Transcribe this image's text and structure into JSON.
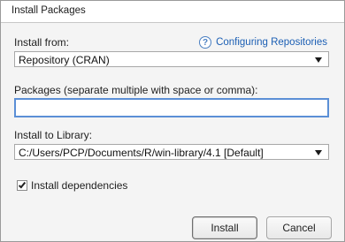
{
  "window": {
    "title": "Install Packages"
  },
  "install_from": {
    "label": "Install from:",
    "selected": "Repository (CRAN)",
    "help_link": "Configuring Repositories",
    "help_icon": "question-circle-icon"
  },
  "packages": {
    "label": "Packages (separate multiple with space or comma):",
    "value": ""
  },
  "library": {
    "label": "Install to Library:",
    "selected": "C:/Users/PCP/Documents/R/win-library/4.1 [Default]"
  },
  "dependencies": {
    "label": "Install dependencies",
    "checked": true
  },
  "buttons": {
    "install": "Install",
    "cancel": "Cancel"
  },
  "colors": {
    "focus_border": "#5b8fd6",
    "link": "#1c5fb4"
  }
}
